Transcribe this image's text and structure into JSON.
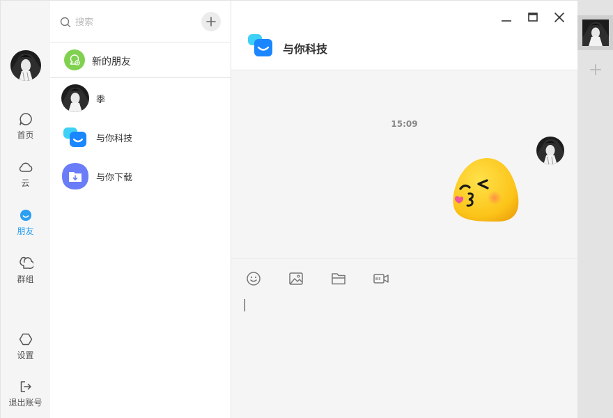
{
  "nav": {
    "items": [
      {
        "label": "首页",
        "icon": "chat-bubble-icon"
      },
      {
        "label": "云",
        "icon": "cloud-icon"
      },
      {
        "label": "朋友",
        "icon": "friend-icon"
      },
      {
        "label": "群组",
        "icon": "group-icon"
      }
    ],
    "settings": {
      "label": "设置",
      "icon": "hexagon-icon"
    },
    "logout": {
      "label": "退出账号",
      "icon": "logout-icon"
    },
    "active_color": "#2b9ff2"
  },
  "list": {
    "search_placeholder": "搜索",
    "new_friend_label": "新的朋友",
    "contacts": [
      {
        "name": "季",
        "icon": "anime-avatar"
      },
      {
        "name": "与你科技",
        "icon": "chat-logo-icon"
      },
      {
        "name": "与你下载",
        "icon": "download-folder-icon"
      }
    ]
  },
  "chat": {
    "title": "与你科技",
    "time": "15:09",
    "sticker": "kiss-emoji-icon",
    "tools": [
      "smile-icon",
      "image-icon",
      "folder-icon",
      "video-icon"
    ],
    "input_value": ""
  },
  "colors": {
    "accent": "#2b9ff2",
    "new_friend_green": "#7fd14f",
    "download_purple": "#6a7cf7",
    "logo_blue": "#1a86ff",
    "logo_cyan": "#3fd0f5"
  }
}
